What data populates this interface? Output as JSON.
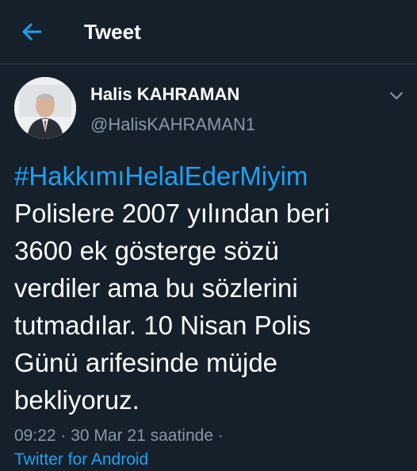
{
  "header": {
    "title": "Tweet"
  },
  "author": {
    "name": "Halis KAHRAMAN",
    "handle": "@HalisKAHRAMAN1"
  },
  "tweet": {
    "hashtag": "#HakkımıHelalEderMiyim",
    "text": "Polislere 2007 yılından beri\n3600 ek gösterge sözü\nverdiler ama bu sözlerini\ntutmadılar. 10 Nisan Polis\nGünü arifesinde müjde\nbekliyoruz.",
    "timestamp": "09:22 · 30 Mar 21 saatinde ·",
    "source": "Twitter for Android"
  },
  "icons": {
    "back": "arrow-left-icon",
    "more": "chevron-down-icon"
  },
  "colors": {
    "background": "#15202b",
    "accent": "#1da1f2",
    "secondary_text": "#8899a6",
    "primary_text": "#ffffff"
  }
}
